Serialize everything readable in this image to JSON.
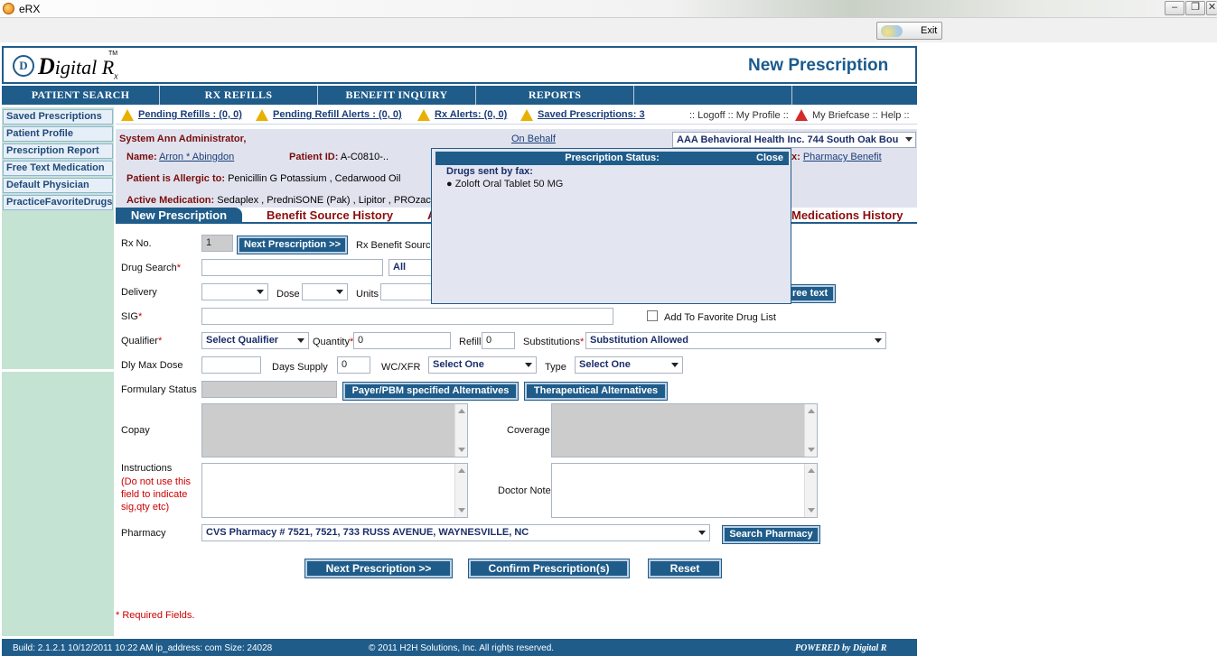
{
  "window": {
    "title": "eRX",
    "minimize": "–",
    "restore": "❐",
    "close": "✕"
  },
  "toolbar": {
    "exit_label": "Exit"
  },
  "header": {
    "logo_letter": "D",
    "logo_text_big": "D",
    "logo_text_rest": "igital R",
    "logo_sub": "x",
    "tm": "TM",
    "page_title": "New Prescription"
  },
  "nav": [
    "PATIENT SEARCH",
    "RX REFILLS",
    "BENEFIT INQUIRY",
    "REPORTS",
    "",
    ""
  ],
  "sidebar": [
    "Saved Prescriptions",
    "Patient Profile",
    "Prescription Report",
    "Free Text Medication",
    "Default Physician",
    "PracticeFavoriteDrugs"
  ],
  "alerts": {
    "pending_refills": "Pending Refills : (0, 0)",
    "pending_refill_alerts": "Pending Refill Alerts : (0, 0)",
    "rx_alerts": "Rx Alerts: (0, 0)",
    "saved_prescriptions": "Saved Prescriptions: 3",
    "logoff": ":: Logoff :: My Profile ::",
    "briefcase": "My Briefcase :: Help ::"
  },
  "patient": {
    "user": "System Ann Administrator,",
    "on_behalf": "On Behalf",
    "org": "AAA Behavioral Health Inc. 744 South Oak Bou",
    "name_label": "Name:",
    "name": "Arron * Abingdon",
    "id_label": "Patient ID:",
    "id": "A-C0810-..",
    "benefit_label": "x:",
    "benefit_link": "Pharmacy Benefit",
    "allergic_label": "Patient is Allergic to:",
    "allergies": "Penicillin G Potassium , Cedarwood Oil",
    "active_label": "Active Medication:",
    "active_meds": "Sedaplex , PredniSONE (Pak) , Lipitor , PROzac ("
  },
  "tabs": {
    "active": "New Prescription",
    "benefit": "Benefit Source History",
    "a": "A",
    "meds": "Medications History"
  },
  "form": {
    "rx_no_label": "Rx No.",
    "rx_no": "1",
    "next_rx_btn": "Next Prescription >>",
    "benefit_source_label": "Rx Benefit Source",
    "drug_search_label": "Drug Search",
    "drug_search_scope": "All",
    "delivery_label": "Delivery",
    "dose_label": "Dose",
    "units_label": "Units",
    "free_text_btn": "ree text",
    "sig_label": "SIG",
    "favorite_label": "Add To Favorite Drug List",
    "qualifier_label": "Qualifier",
    "qualifier_value": "Select Qualifier",
    "quantity_label": "Quantity",
    "quantity": "0",
    "refill_label": "Refill",
    "refill": "0",
    "substitutions_label": "Substitutions",
    "substitutions_value": "Substitution Allowed",
    "dly_max_label": "Dly Max Dose",
    "days_supply_label": "Days Supply",
    "days_supply": "0",
    "wc_label": "WC/XFR",
    "wc_value": "Select One",
    "type_label": "Type",
    "type_value": "Select One",
    "formulary_label": "Formulary Status",
    "payer_btn": "Payer/PBM specified Alternatives",
    "therapeutic_btn": "Therapeutical Alternatives",
    "copay_label": "Copay",
    "coverage_label": "Coverage",
    "instructions_label": "Instructions",
    "instructions_note": "(Do not use this field to indicate sig,qty etc)",
    "doctor_note_label": "Doctor Note",
    "pharmacy_label": "Pharmacy",
    "pharmacy_value": "CVS Pharmacy # 7521, 7521, 733 RUSS AVENUE, WAYNESVILLE, NC",
    "search_pharmacy_btn": "Search Pharmacy",
    "next_btn": "Next Prescription >>",
    "confirm_btn": "Confirm Prescription(s)",
    "reset_btn": "Reset",
    "required_note": "Required Fields.",
    "asterisk": "*"
  },
  "popup": {
    "title": "Prescription Status:",
    "close": "Close",
    "subtitle": "Drugs sent by fax:",
    "items": [
      "Zoloft Oral Tablet 50 MG"
    ]
  },
  "footer": {
    "build": "Build: 2.1.2.1 10/12/2011 10:22 AM ip_address: com Size: 24028",
    "copyright": "© 2011 H2H Solutions, Inc. All rights reserved.",
    "powered": "POWERED by Digital R"
  },
  "colors": {
    "brand": "#1f5c8a",
    "sidebar": "#c5e3d2",
    "alert_link": "#1a3d7a",
    "label_dark": "#7a0d0d"
  }
}
